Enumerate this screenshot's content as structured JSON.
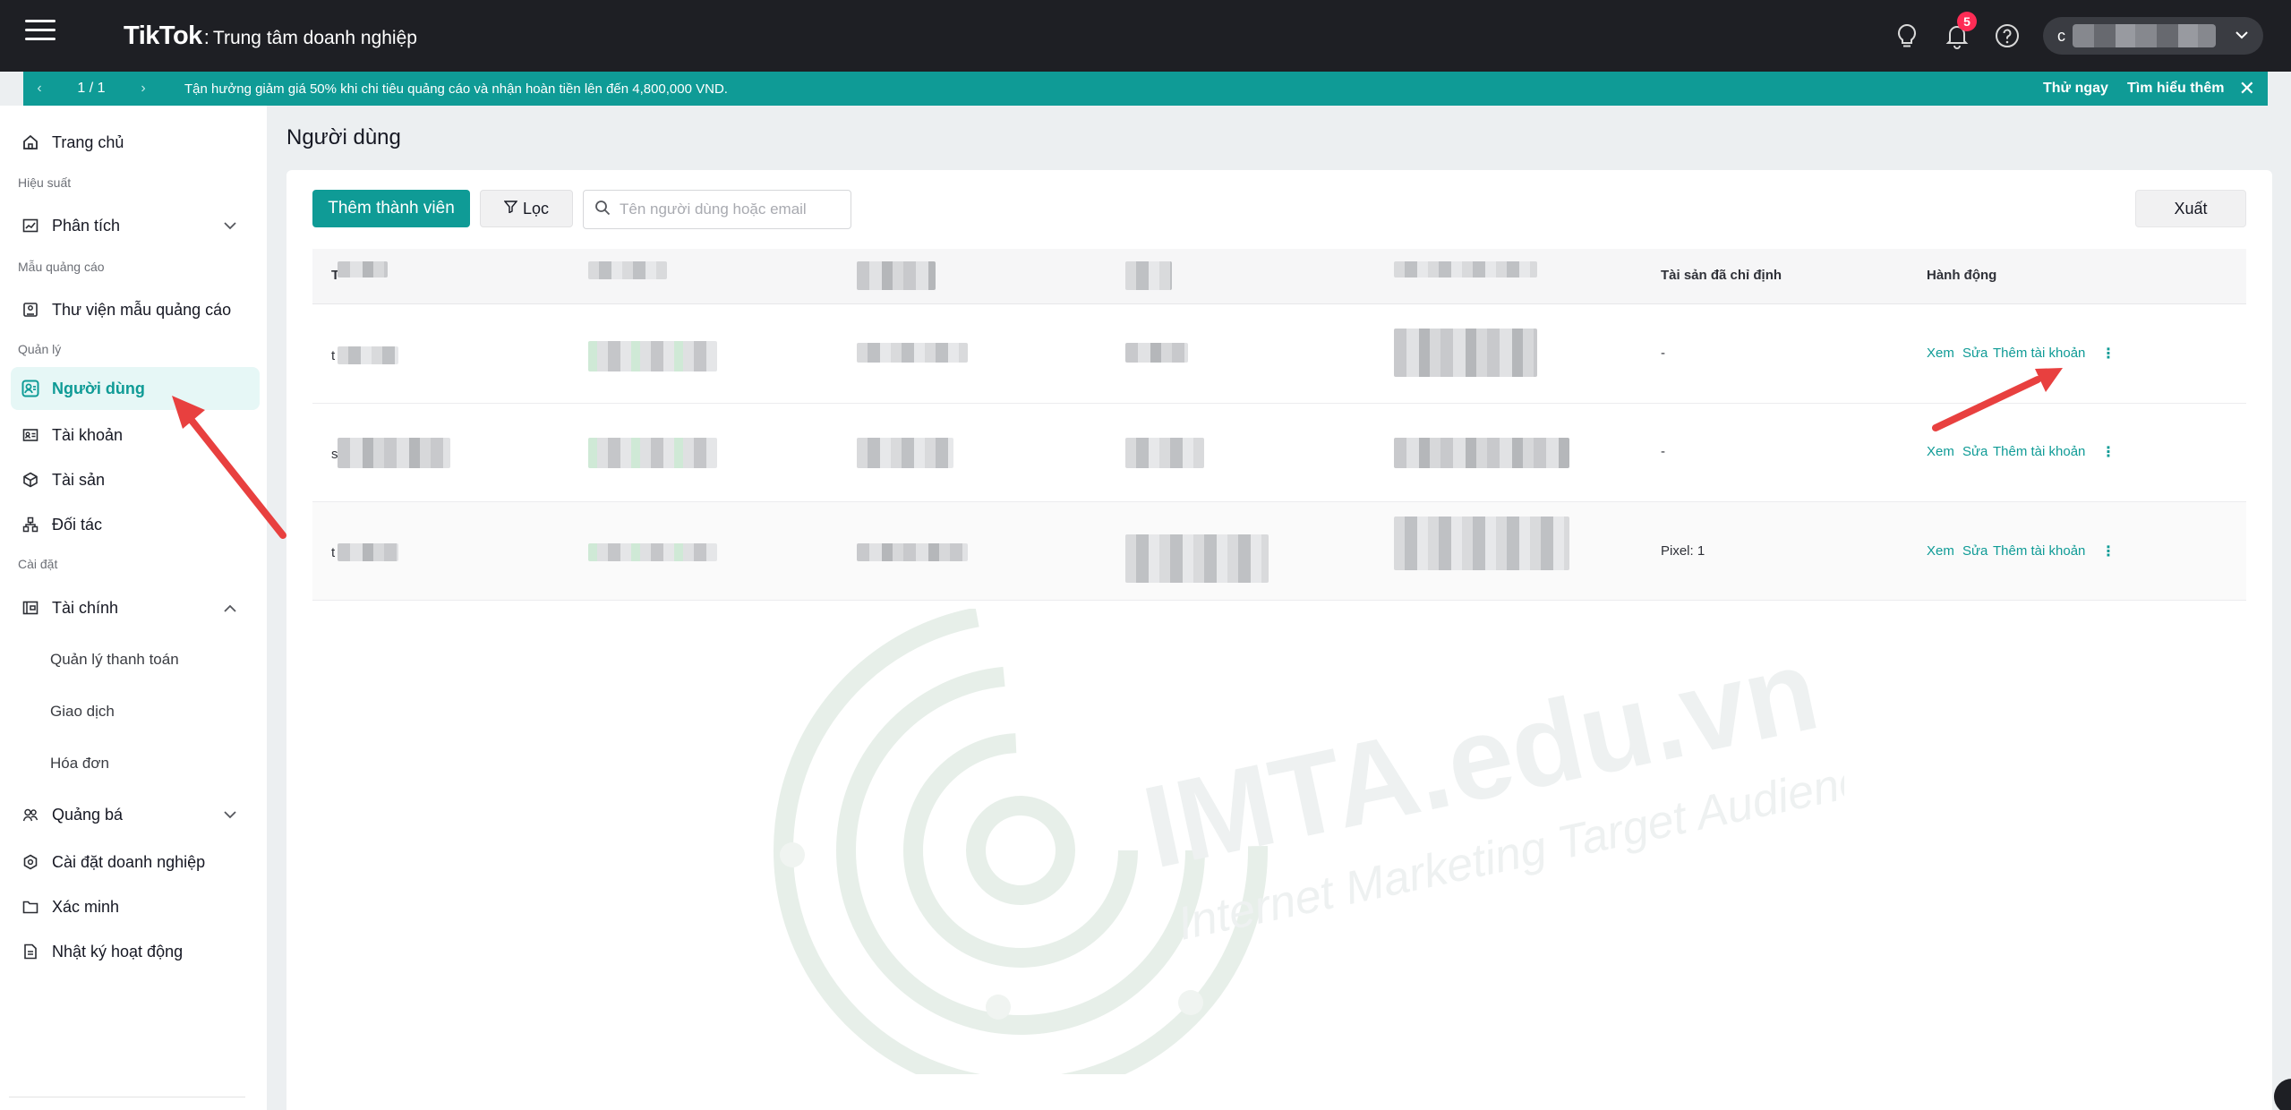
{
  "header": {
    "logo": "TikTok",
    "separator": ":",
    "subtitle": "Trung tâm doanh nghiệp",
    "notification_count": "5",
    "account_initial": "c"
  },
  "promo": {
    "pager": "1 / 1",
    "message": "Tận hưởng giảm giá 50% khi chi tiêu quảng cáo và nhận hoàn tiền lên đến 4,800,000 VND.",
    "try_now": "Thử ngay",
    "learn_more": "Tìm hiểu thêm"
  },
  "sidebar": {
    "home": "Trang chủ",
    "section_performance": "Hiệu suất",
    "analytics": "Phân tích",
    "section_templates": "Mẫu quảng cáo",
    "template_library": "Thư viện mẫu quảng cáo",
    "section_manage": "Quản lý",
    "users": "Người dùng",
    "accounts": "Tài khoản",
    "assets": "Tài sản",
    "partners": "Đối tác",
    "section_settings": "Cài đặt",
    "finance": "Tài chính",
    "payment_management": "Quản lý thanh toán",
    "transactions": "Giao dịch",
    "invoices": "Hóa đơn",
    "promotion": "Quảng bá",
    "business_settings": "Cài đặt doanh nghiệp",
    "verification": "Xác minh",
    "activity_log": "Nhật ký hoạt động"
  },
  "main": {
    "title": "Người dùng",
    "add_member": "Thêm thành viên",
    "filter": "Lọc",
    "search_placeholder": "Tên người dùng hoặc email",
    "export": "Xuất"
  },
  "table": {
    "columns": {
      "first_char": "T",
      "assigned_assets": "Tài sản đã chỉ định",
      "actions": "Hành động"
    },
    "rows": [
      {
        "first_char": "t",
        "assigned_assets": "-"
      },
      {
        "first_char": "s",
        "assigned_assets": "-"
      },
      {
        "first_char": "t",
        "assigned_assets": "Pixel: 1"
      }
    ],
    "action_view": "Xem",
    "action_edit": "Sửa",
    "action_add_account": "Thêm tài khoản",
    "action_more": "⋮"
  },
  "watermark": {
    "title": "IMTA.edu.vn",
    "tagline": "Internet Marketing Target Audience"
  },
  "colors": {
    "accent": "#0f9b96",
    "header_bg": "#1e1f24",
    "badge": "#fe2c55",
    "annotation_arrow": "#e8403f"
  },
  "icons": {
    "menu": "hamburger-icon",
    "idea": "lightbulb-icon",
    "notifications": "bell-icon",
    "help": "question-icon"
  }
}
